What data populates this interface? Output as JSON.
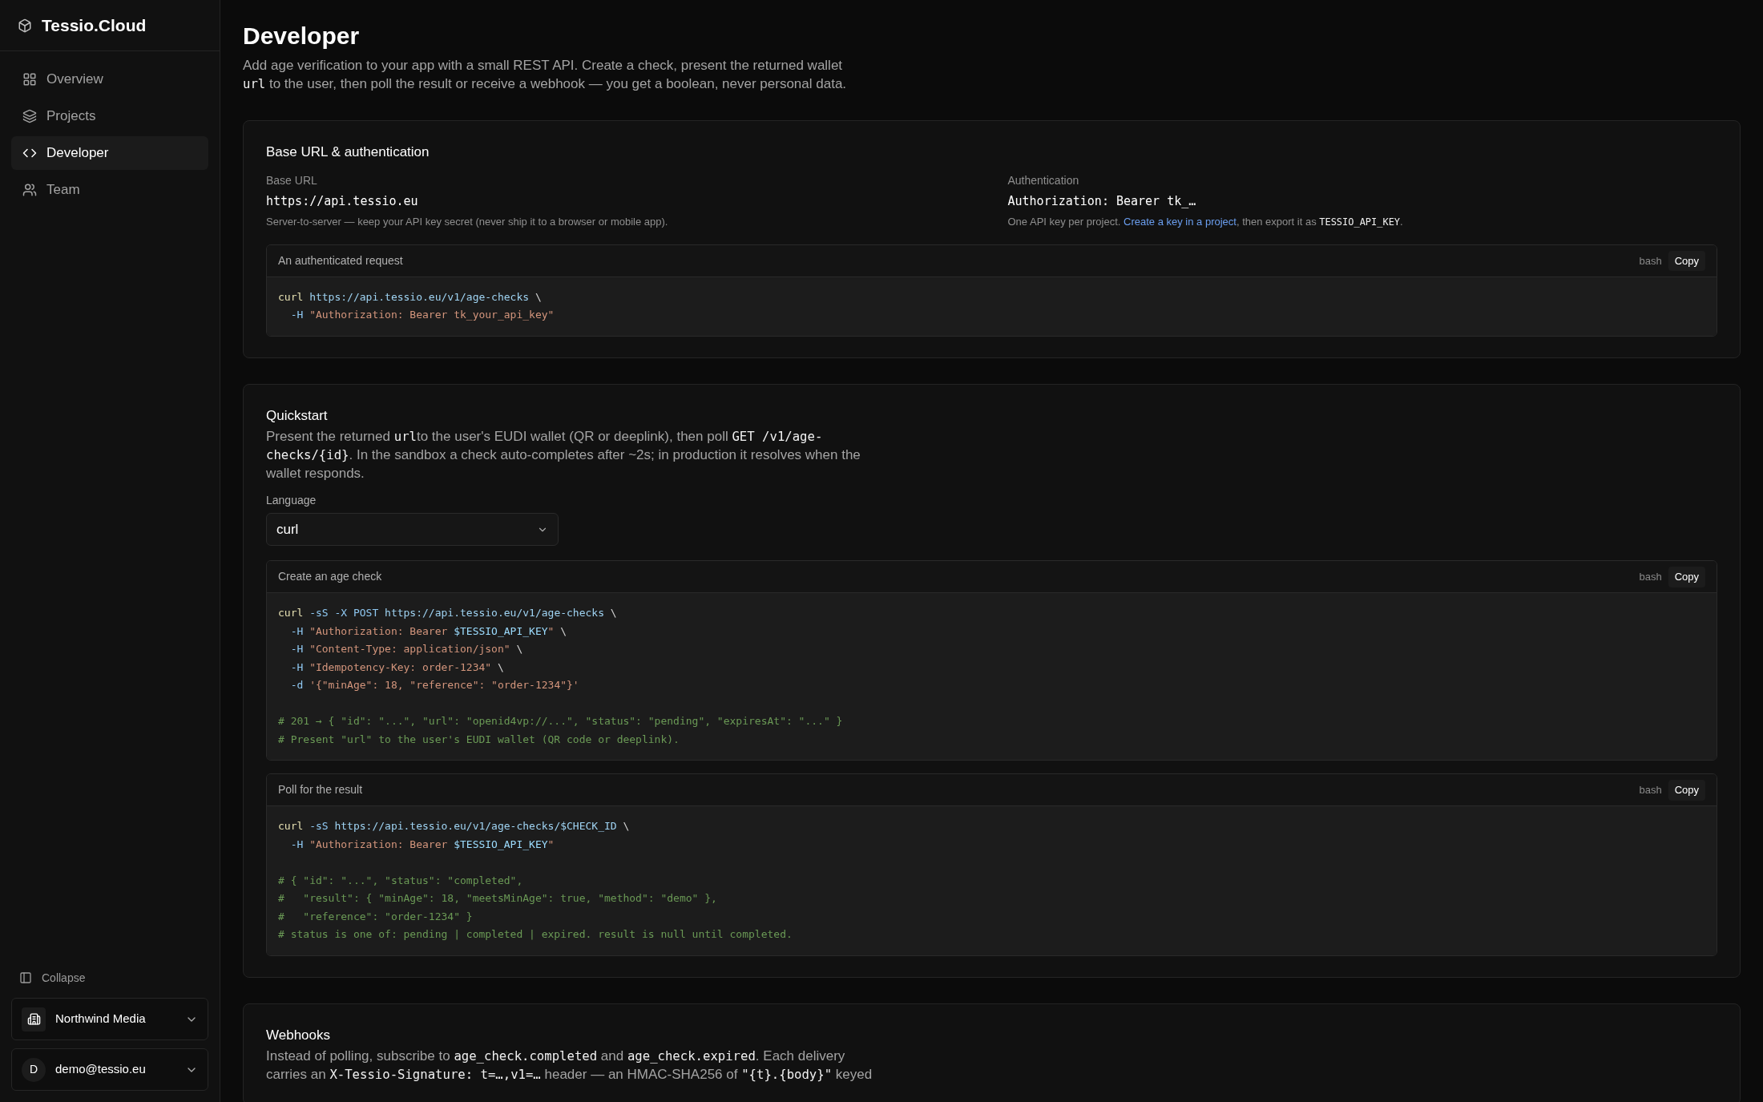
{
  "sidebar": {
    "brand": "Tessio.Cloud",
    "nav": [
      {
        "label": "Overview",
        "selected": false
      },
      {
        "label": "Projects",
        "selected": false
      },
      {
        "label": "Developer",
        "selected": true
      },
      {
        "label": "Team",
        "selected": false
      }
    ],
    "collapse": "Collapse",
    "org": {
      "name": "Northwind Media"
    },
    "user": {
      "initial": "D",
      "email": "demo@tessio.eu"
    }
  },
  "page": {
    "title": "Developer",
    "intro": [
      {
        "text": "Add age verification to your app with a small REST API. Create a check, present the returned wallet ",
        "kind": "text"
      },
      {
        "text": "url",
        "kind": "code"
      },
      {
        "text": " to the user, then poll the result or receive a webhook — you get a boolean, never personal data.",
        "kind": "text"
      }
    ]
  },
  "sections": [
    {
      "title": "Base URL & authentication",
      "fields": [
        {
          "label": "Base URL",
          "value": "https://api.tessio.eu",
          "note": [
            {
              "text": "Server-to-server — keep your API key secret (never ship it to a browser or mobile app).",
              "kind": "text"
            }
          ]
        },
        {
          "label": "Authentication",
          "value": "Authorization: Bearer tk_…",
          "note": [
            {
              "text": "One API key per project. ",
              "kind": "text"
            },
            {
              "text": "Create a key in a project",
              "kind": "link"
            },
            {
              "text": ", then export it as ",
              "kind": "text"
            },
            {
              "text": "TESSIO_API_KEY",
              "kind": "code"
            },
            {
              "text": ".",
              "kind": "text"
            }
          ]
        }
      ],
      "code_blocks": [
        {
          "title": "An authenticated request",
          "lang": "bash",
          "copy": "Copy",
          "groups": [
            [
              [
                {
                  "text": "curl ",
                  "kind": "cmd"
                },
                {
                  "text": "https://api.tessio.eu/v1/age-checks",
                  "kind": "url"
                },
                {
                  "text": " \\",
                  "kind": "plain"
                }
              ],
              [
                {
                  "text": "  -H ",
                  "kind": "flag"
                },
                {
                  "text": "\"Authorization: Bearer tk_your_api_key\"",
                  "kind": "string"
                }
              ]
            ]
          ]
        }
      ]
    },
    {
      "title": "Quickstart",
      "text": [
        {
          "text": "Present the returned ",
          "kind": "text"
        },
        {
          "text": "url",
          "kind": "code"
        },
        {
          "text": "to the user's EUDI wallet (QR or deeplink), then poll ",
          "kind": "text"
        },
        {
          "text": "GET /v1/age-checks/{id}",
          "kind": "code"
        },
        {
          "text": ". In the sandbox a check auto-completes after ~2s; in production it resolves when the wallet responds.",
          "kind": "text"
        }
      ],
      "select": {
        "label": "Language",
        "value": "curl"
      },
      "code_blocks": [
        {
          "title": "Create an age check",
          "lang": "bash",
          "copy": "Copy",
          "groups": [
            [
              [
                {
                  "text": "curl ",
                  "kind": "cmd"
                },
                {
                  "text": "-sS -X POST ",
                  "kind": "flag"
                },
                {
                  "text": "https://api.tessio.eu/v1/age-checks",
                  "kind": "url"
                },
                {
                  "text": " \\",
                  "kind": "plain"
                }
              ],
              [
                {
                  "text": "  -H ",
                  "kind": "flag"
                },
                {
                  "text": "\"Authorization: Bearer ",
                  "kind": "string"
                },
                {
                  "text": "$TESSIO_API_KEY",
                  "kind": "var"
                },
                {
                  "text": "\"",
                  "kind": "string"
                },
                {
                  "text": " \\",
                  "kind": "plain"
                }
              ],
              [
                {
                  "text": "  -H ",
                  "kind": "flag"
                },
                {
                  "text": "\"Content-Type: application/json\"",
                  "kind": "string"
                },
                {
                  "text": " \\",
                  "kind": "plain"
                }
              ],
              [
                {
                  "text": "  -H ",
                  "kind": "flag"
                },
                {
                  "text": "\"Idempotency-Key: order-1234\"",
                  "kind": "string"
                },
                {
                  "text": " \\",
                  "kind": "plain"
                }
              ],
              [
                {
                  "text": "  -d ",
                  "kind": "flag"
                },
                {
                  "text": "'{\"minAge\": 18, \"reference\": \"order-1234\"}'",
                  "kind": "string"
                }
              ]
            ],
            [
              [
                {
                  "text": "# 201 → { \"id\": \"...\", \"url\": \"openid4vp://...\", \"status\": \"pending\", \"expiresAt\": \"...\" }",
                  "kind": "comment"
                }
              ],
              [
                {
                  "text": "# Present \"url\" to the user's EUDI wallet (QR code or deeplink).",
                  "kind": "comment"
                }
              ]
            ]
          ]
        },
        {
          "title": "Poll for the result",
          "lang": "bash",
          "copy": "Copy",
          "groups": [
            [
              [
                {
                  "text": "curl ",
                  "kind": "cmd"
                },
                {
                  "text": "-sS ",
                  "kind": "flag"
                },
                {
                  "text": "https://api.tessio.eu/v1/age-checks/$CHECK_ID",
                  "kind": "url"
                },
                {
                  "text": " \\",
                  "kind": "plain"
                }
              ],
              [
                {
                  "text": "  -H ",
                  "kind": "flag"
                },
                {
                  "text": "\"Authorization: Bearer ",
                  "kind": "string"
                },
                {
                  "text": "$TESSIO_API_KEY",
                  "kind": "var"
                },
                {
                  "text": "\"",
                  "kind": "string"
                }
              ]
            ],
            [
              [
                {
                  "text": "# { \"id\": \"...\", \"status\": \"completed\",",
                  "kind": "comment"
                }
              ],
              [
                {
                  "text": "#   \"result\": { \"minAge\": 18, \"meetsMinAge\": true, \"method\": \"demo\" },",
                  "kind": "comment"
                }
              ],
              [
                {
                  "text": "#   \"reference\": \"order-1234\" }",
                  "kind": "comment"
                }
              ],
              [
                {
                  "text": "# status is one of: pending | completed | expired. result is null until completed.",
                  "kind": "comment"
                }
              ]
            ]
          ]
        }
      ]
    },
    {
      "title": "Webhooks",
      "text": [
        {
          "text": "Instead of polling, subscribe to ",
          "kind": "text"
        },
        {
          "text": "age_check.completed",
          "kind": "code"
        },
        {
          "text": " and ",
          "kind": "text"
        },
        {
          "text": "age_check.expired",
          "kind": "code"
        },
        {
          "text": ". Each delivery carries an ",
          "kind": "text"
        },
        {
          "text": "X-Tessio-Signature: t=…,v1=…",
          "kind": "code"
        },
        {
          "text": " header — an HMAC-SHA256 of ",
          "kind": "text"
        },
        {
          "text": "\"{t}.{body}\"",
          "kind": "code"
        },
        {
          "text": " keyed",
          "kind": "text"
        }
      ]
    }
  ]
}
